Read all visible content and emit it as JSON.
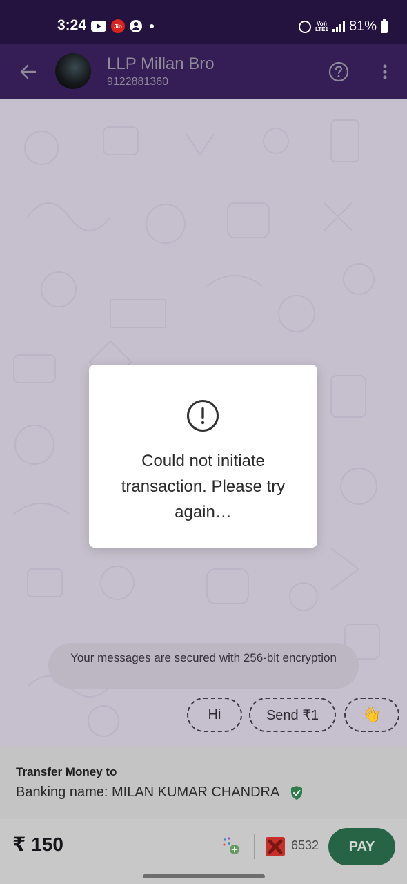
{
  "status_bar": {
    "time": "3:24",
    "carrier_badge": "Jio",
    "network_label_top": "Vo))",
    "network_label_bottom": "LTE1",
    "battery": "81%",
    "icons": [
      "youtube-icon",
      "jio-icon",
      "user-icon",
      "dot-icon",
      "alarm-icon",
      "signal-icon",
      "battery-icon"
    ]
  },
  "header": {
    "contact_name": "LLP Millan Bro",
    "contact_number": "9122881360",
    "icons": [
      "back-arrow-icon",
      "help-icon",
      "more-vertical-icon"
    ]
  },
  "modal": {
    "icon": "alert-circle-icon",
    "message": "Could not initiate transaction. Please try again…"
  },
  "chat": {
    "encryption_notice": "Your messages are secured with 256-bit encryption",
    "quick_replies": [
      "Hi",
      "Send ₹1",
      "👋"
    ]
  },
  "transfer": {
    "title": "Transfer Money to",
    "banking_name": "Banking name: MILAN KUMAR CHANDRA",
    "verified_color": "#2f7d4a"
  },
  "pay_bar": {
    "amount": "₹ 150",
    "account_last4": "6532",
    "pay_label": "PAY",
    "pay_color": "#276446"
  }
}
